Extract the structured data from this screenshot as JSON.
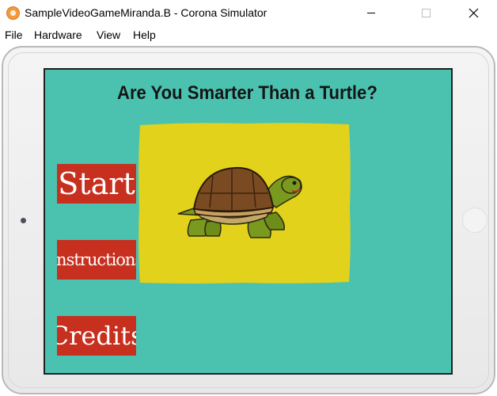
{
  "window": {
    "title": "SampleVideoGameMiranda.B - Corona Simulator"
  },
  "menubar": {
    "items": [
      "File",
      "Hardware",
      "View",
      "Help"
    ]
  },
  "game": {
    "title": "Are You Smarter Than a Turtle?",
    "buttons": {
      "start": "Start",
      "instructions": "Instructions",
      "credits": "Credits"
    }
  },
  "colors": {
    "screen_bg": "#4bc2b0",
    "image_panel": "#e2d21c",
    "button_red": "#c7301f",
    "title_text": "#151515"
  },
  "icons": {
    "app": "corona-app-icon",
    "minimize": "minimize-icon",
    "maximize": "maximize-icon",
    "close": "close-icon",
    "hero": "turtle-illustration"
  }
}
